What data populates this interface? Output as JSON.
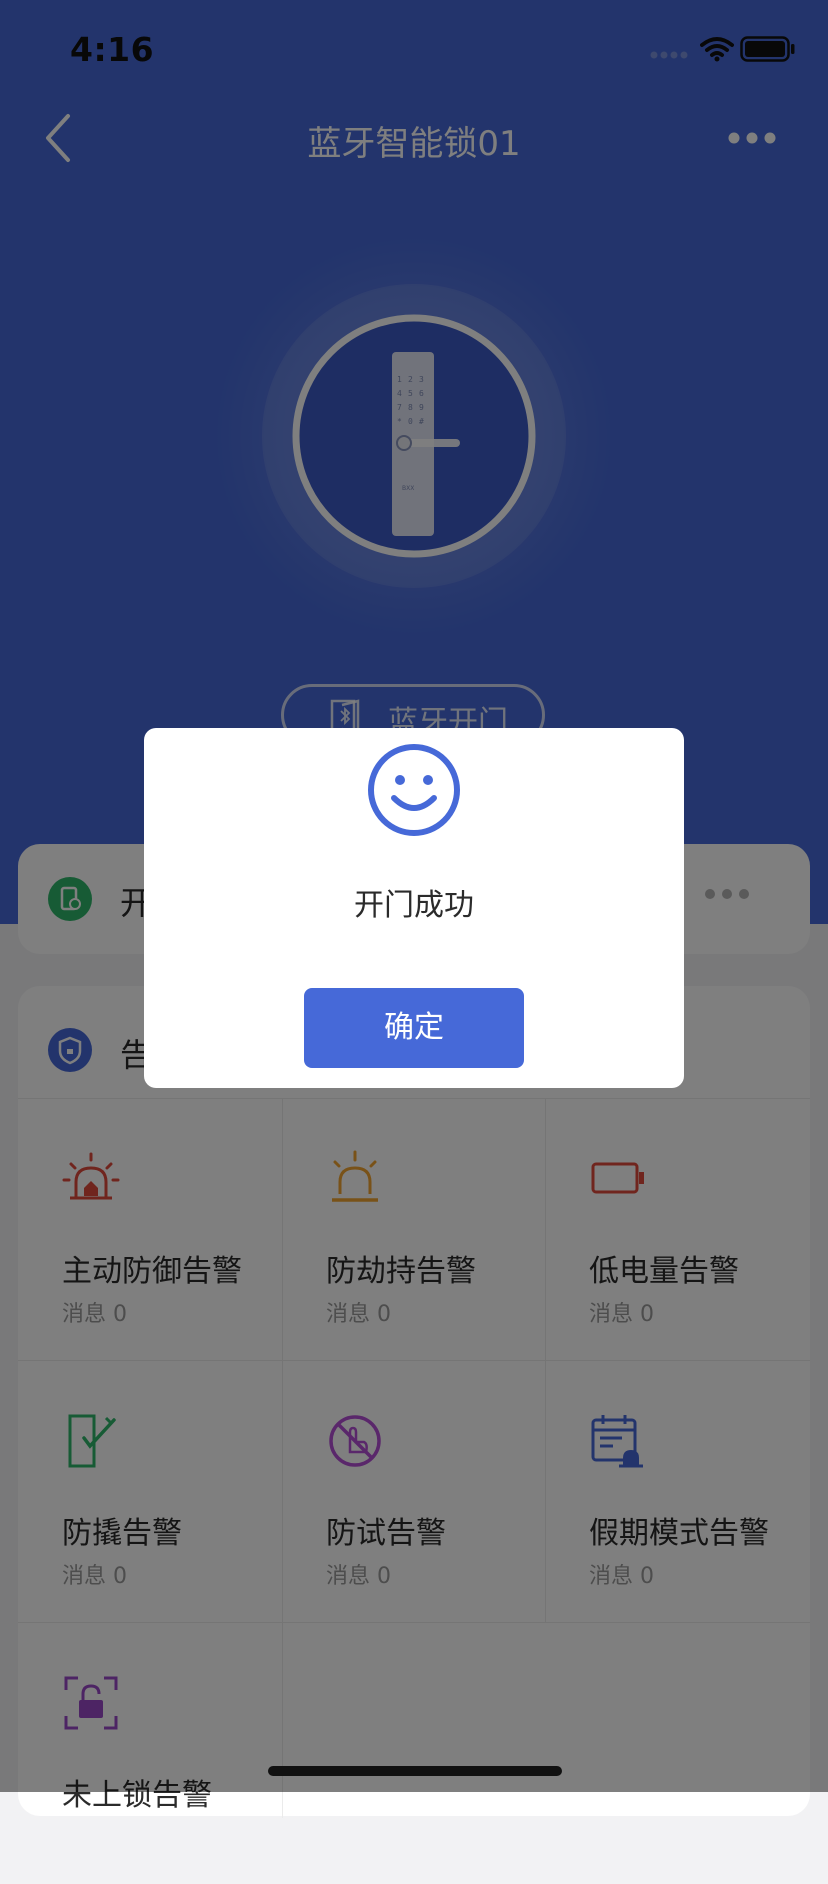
{
  "status_bar": {
    "time": "4:16"
  },
  "nav": {
    "title": "蓝牙智能锁01"
  },
  "hero": {
    "lock_brand": "BXX",
    "keypad": [
      "1",
      "2",
      "3",
      "4",
      "5",
      "6",
      "7",
      "8",
      "9",
      "*",
      "0",
      "#"
    ],
    "ble_unlock_label": "蓝牙开门"
  },
  "record_card": {
    "title": "开"
  },
  "alarm_card": {
    "title": "告",
    "items": [
      {
        "title": "主动防御告警",
        "count": "消息 0",
        "icon": "siren-home-icon",
        "color": "#e04a3d"
      },
      {
        "title": "防劫持告警",
        "count": "消息 0",
        "icon": "siren-icon",
        "color": "#f2a531"
      },
      {
        "title": "低电量告警",
        "count": "消息 0",
        "icon": "low-battery-icon",
        "color": "#e04a3d"
      },
      {
        "title": "防撬告警",
        "count": "消息 0",
        "icon": "door-pry-icon",
        "color": "#2fb66a"
      },
      {
        "title": "防试告警",
        "count": "消息 0",
        "icon": "no-touch-icon",
        "color": "#b44fd6"
      },
      {
        "title": "假期模式告警",
        "count": "消息 0",
        "icon": "calendar-alarm-icon",
        "color": "#4669d8"
      },
      {
        "title": "未上锁告警",
        "count": "",
        "icon": "unlock-frame-icon",
        "color": "#9b49c9"
      }
    ]
  },
  "dialog": {
    "message": "开门成功",
    "confirm_label": "确定",
    "accent": "#4669d8"
  }
}
